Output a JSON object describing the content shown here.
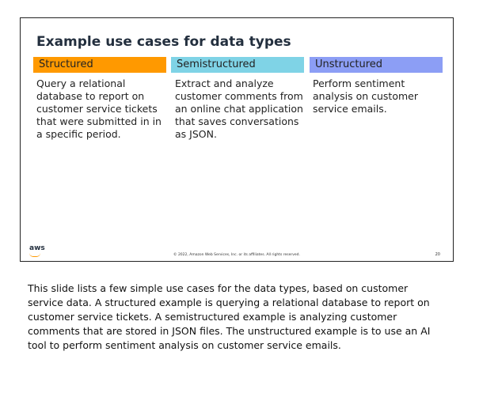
{
  "slide": {
    "title": "Example use cases for data types",
    "columns": [
      {
        "header": "Structured",
        "color": "#ff9900",
        "body": "Query a relational database to report on customer service tickets that were submitted in in a specific period."
      },
      {
        "header": "Semistructured",
        "color": "#7fd3e6",
        "body": "Extract and analyze customer comments from an online chat application that saves conversations as JSON."
      },
      {
        "header": "Unstructured",
        "color": "#8c9ef5",
        "body": "Perform sentiment analysis on customer service emails."
      }
    ],
    "footer": {
      "logo_text": "aws",
      "copyright": "© 2022, Amazon Web Services, Inc. or its affiliates. All rights reserved.",
      "page_number": "20"
    }
  },
  "notes": "This slide lists a few simple use cases for the data types, based on customer service data. A structured example is querying a relational database to report on customer service tickets. A semistructured example is analyzing customer comments that are stored in JSON files. The unstructured example is to use an AI tool to perform sentiment analysis on customer service emails."
}
